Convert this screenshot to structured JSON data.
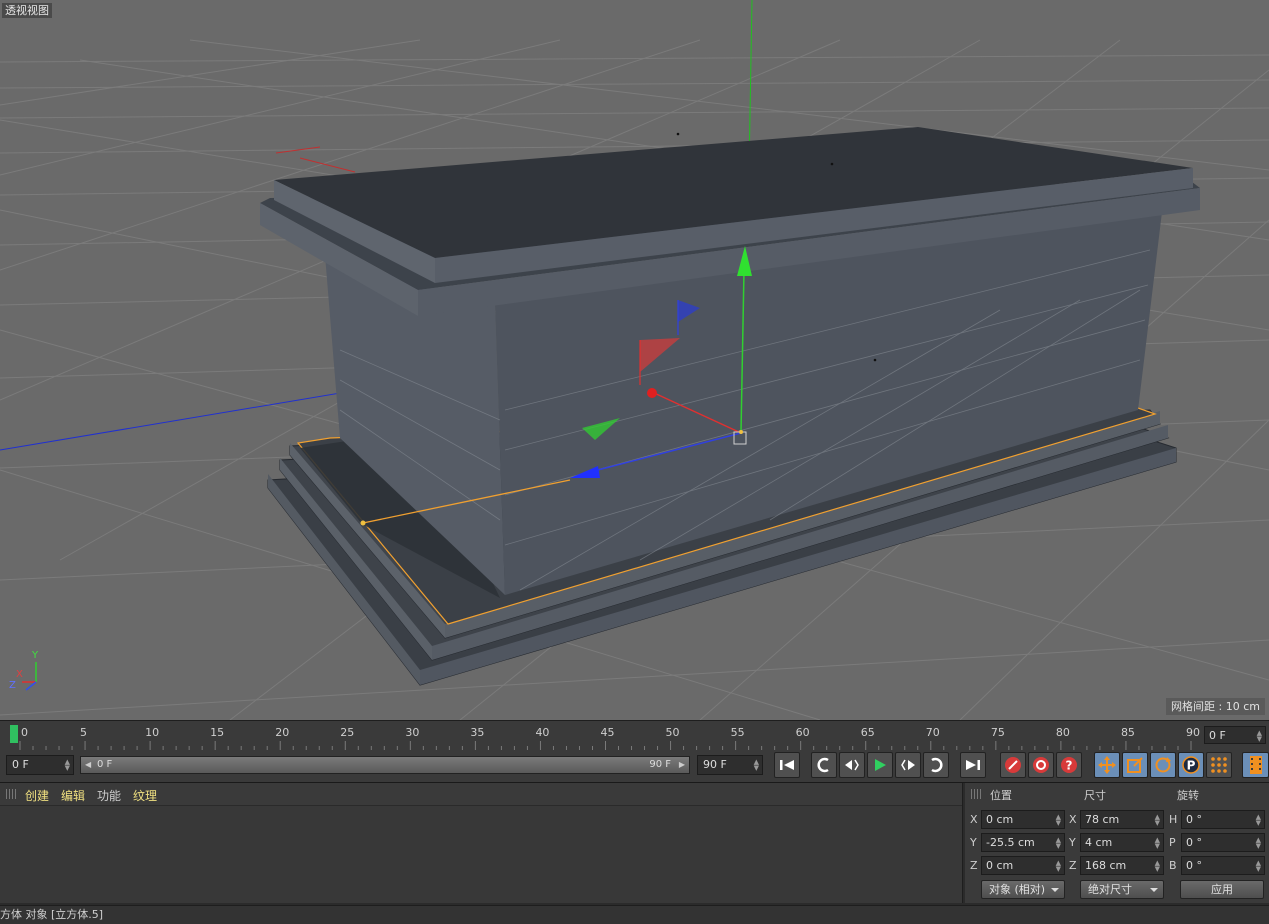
{
  "viewport": {
    "title": "透视视图",
    "grid_spacing": "网格间距 : 10 cm",
    "axis_labels": {
      "x": "X",
      "y": "Y",
      "z": "Z"
    }
  },
  "timeline": {
    "ticks": [
      "0",
      "5",
      "10",
      "15",
      "20",
      "25",
      "30",
      "35",
      "40",
      "45",
      "50",
      "55",
      "60",
      "65",
      "70",
      "75",
      "80",
      "85",
      "90"
    ],
    "current_frame": "0 F"
  },
  "transport": {
    "start_field": "0 F",
    "range_start": "0 F",
    "range_end": "90 F",
    "end_field": "90 F"
  },
  "object_manager": {
    "menus": [
      "创建",
      "编辑",
      "功能",
      "纹理"
    ]
  },
  "coordinates": {
    "headers": {
      "position": "位置",
      "size": "尺寸",
      "rotation": "旋转"
    },
    "position": [
      {
        "axis": "X",
        "value": "0 cm"
      },
      {
        "axis": "Y",
        "value": "-25.5 cm"
      },
      {
        "axis": "Z",
        "value": "0 cm"
      }
    ],
    "size": [
      {
        "axis": "X",
        "value": "78 cm"
      },
      {
        "axis": "Y",
        "value": "4 cm"
      },
      {
        "axis": "Z",
        "value": "168 cm"
      }
    ],
    "rotation": [
      {
        "axis": "H",
        "value": "0 °"
      },
      {
        "axis": "P",
        "value": "0 °"
      },
      {
        "axis": "B",
        "value": "0 °"
      }
    ],
    "mode_dropdown": "对象 (相对)",
    "size_dropdown": "绝对尺寸",
    "apply_label": "应用"
  },
  "status": {
    "text": "方体 对象 [立方体.5]"
  },
  "colors": {
    "viewport_bg": "#6a6a6a",
    "selection": "#f0a030",
    "axis_x": "#e03030",
    "axis_y": "#30d030",
    "axis_z": "#3040e0",
    "timeline_marker": "#30c060"
  }
}
